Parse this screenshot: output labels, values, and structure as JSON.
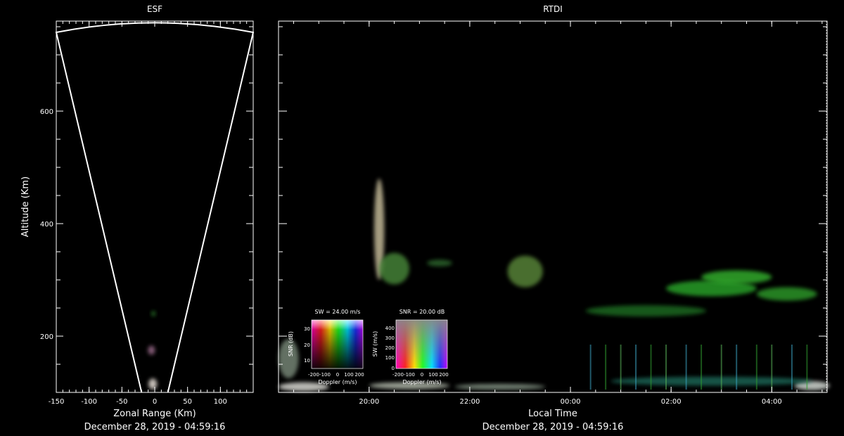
{
  "colors": {
    "background": "#000000",
    "axes": "#ffffff",
    "echo_green": "#2fbf2a"
  },
  "chart_data": [
    {
      "type": "scatter",
      "title": "ESF",
      "xlabel": "Zonal Range (Km)",
      "ylabel": "Altitude (Km)",
      "caption": "December 28, 2019 - 04:59:16",
      "xlim": [
        -150,
        150
      ],
      "ylim": [
        100,
        760
      ],
      "x_ticks": [
        -150,
        -100,
        -50,
        0,
        50,
        100
      ],
      "y_ticks": [
        200,
        400,
        600
      ],
      "beam_fan": {
        "apex_altitude": 100,
        "half_width_at_base": 20,
        "top_altitude": 740,
        "half_width_at_top": 150,
        "arc_peak_altitude": 757
      },
      "echoes": [
        {
          "x": -3,
          "y": 115,
          "size": 6,
          "color": "#e8e0d8"
        },
        {
          "x": -5,
          "y": 175,
          "size": 5,
          "color": "#9a6a8a"
        },
        {
          "x": -2,
          "y": 240,
          "size": 3,
          "color": "#2c7a2c"
        }
      ]
    },
    {
      "type": "heatmap",
      "title": "RTDI",
      "xlabel": "Local Time",
      "caption": "December 28, 2019 - 04:59:16",
      "x_tick_labels": [
        "20:00",
        "22:00",
        "00:00",
        "02:00",
        "04:00"
      ],
      "x_tick_hours": [
        20,
        22,
        24,
        26,
        28
      ],
      "xlim_hours": [
        18.2,
        29.1
      ],
      "ylim": [
        100,
        760
      ],
      "echo_regions": [
        {
          "t": 20.2,
          "alt": 390,
          "rx": 0.1,
          "ry": 90,
          "color": "#cfc4a0"
        },
        {
          "t": 20.5,
          "alt": 320,
          "rx": 0.3,
          "ry": 28,
          "color": "#4a8a3a"
        },
        {
          "t": 21.4,
          "alt": 330,
          "rx": 0.25,
          "ry": 6,
          "color": "#2d6a2d"
        },
        {
          "t": 23.1,
          "alt": 315,
          "rx": 0.35,
          "ry": 28,
          "color": "#5c8a3a"
        },
        {
          "t": 26.8,
          "alt": 285,
          "rx": 0.9,
          "ry": 14,
          "color": "#2aa82a"
        },
        {
          "t": 27.3,
          "alt": 305,
          "rx": 0.7,
          "ry": 12,
          "color": "#35b52f"
        },
        {
          "t": 28.3,
          "alt": 275,
          "rx": 0.6,
          "ry": 12,
          "color": "#2e9e2c"
        },
        {
          "t": 25.5,
          "alt": 245,
          "rx": 1.2,
          "ry": 10,
          "color": "#1f6e22"
        },
        {
          "t": 18.7,
          "alt": 110,
          "rx": 0.5,
          "ry": 8,
          "color": "#e6e6e0"
        },
        {
          "t": 20.8,
          "alt": 112,
          "rx": 0.8,
          "ry": 6,
          "color": "#bfc7b8"
        },
        {
          "t": 22.6,
          "alt": 110,
          "rx": 0.9,
          "ry": 5,
          "color": "#8fa090"
        },
        {
          "t": 28.8,
          "alt": 112,
          "rx": 0.35,
          "ry": 8,
          "color": "#e0e6e0"
        },
        {
          "t": 26.8,
          "alt": 120,
          "rx": 2.0,
          "ry": 8,
          "color": "#1e6a5a"
        },
        {
          "t": 18.4,
          "alt": 160,
          "rx": 0.2,
          "ry": 35,
          "color": "#7c8c7c"
        }
      ],
      "echo_columns_hours": [
        24.4,
        24.7,
        25.0,
        25.3,
        25.6,
        25.9,
        26.3,
        26.6,
        27.0,
        27.3,
        27.7,
        28.0,
        28.4,
        28.7
      ],
      "legends": [
        {
          "title": "SW = 24.00 m/s",
          "ylabel": "SNR (dB)",
          "y_ticks": [
            "30",
            "20",
            "10"
          ],
          "xlabel": "Doppler (m/s)",
          "x_ticks": [
            "-200",
            "-100",
            "0",
            "100",
            "200"
          ]
        },
        {
          "title": "SNR = 20.00 dB",
          "ylabel": "SW (m/s)",
          "y_ticks": [
            "400",
            "300",
            "200",
            "100",
            "0"
          ],
          "xlabel": "Doppler (m/s)",
          "x_ticks": [
            "-200",
            "-100",
            "0",
            "100",
            "200"
          ]
        }
      ]
    }
  ]
}
